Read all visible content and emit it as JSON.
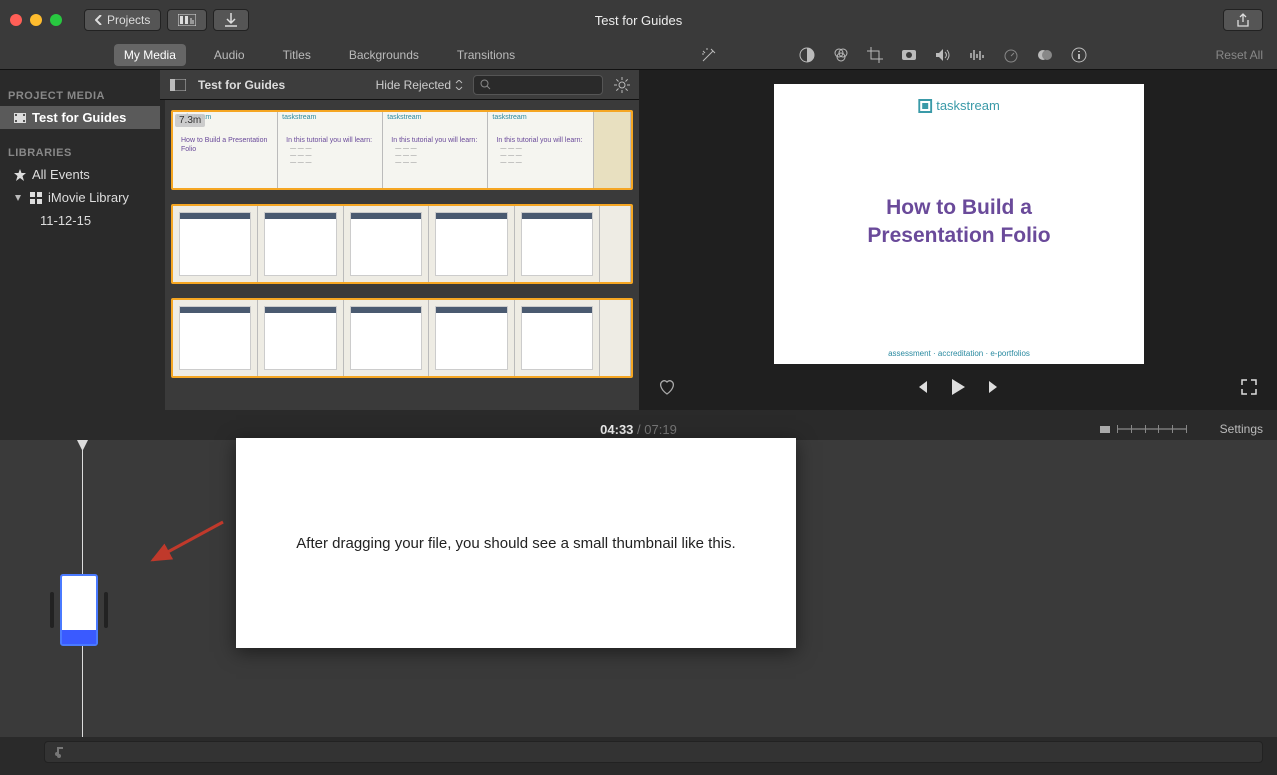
{
  "titlebar": {
    "back_label": "Projects",
    "title": "Test for Guides"
  },
  "tabs": {
    "items": [
      "My Media",
      "Audio",
      "Titles",
      "Backgrounds",
      "Transitions"
    ],
    "active_index": 0,
    "reset_label": "Reset All"
  },
  "secbar": {
    "project_name": "Test for Guides",
    "filter_label": "Hide Rejected"
  },
  "sidebar": {
    "heading_project": "PROJECT MEDIA",
    "project_item": "Test for Guides",
    "heading_lib": "LIBRARIES",
    "all_events": "All Events",
    "library_name": "iMovie Library",
    "event_name": "11-12-15"
  },
  "browser": {
    "clip_duration": "7.3m",
    "thumb_brand": "taskstream",
    "thumb_heading": "How to Build a Presentation Folio",
    "thumb_sub": "In this tutorial you will learn:"
  },
  "preview": {
    "brand": "taskstream",
    "title_line1": "How to Build a",
    "title_line2": "Presentation Folio",
    "footer": "assessment · accreditation · e-portfolios"
  },
  "timecode": {
    "current": "04:33",
    "separator": "/",
    "total": "07:19",
    "settings_label": "Settings"
  },
  "annotation": {
    "text": "After dragging your file, you should see a small thumbnail like this."
  },
  "colors": {
    "accent_purple": "#6a4a9a",
    "accent_teal": "#2a8aa0",
    "clip_border": "#f5a623"
  }
}
